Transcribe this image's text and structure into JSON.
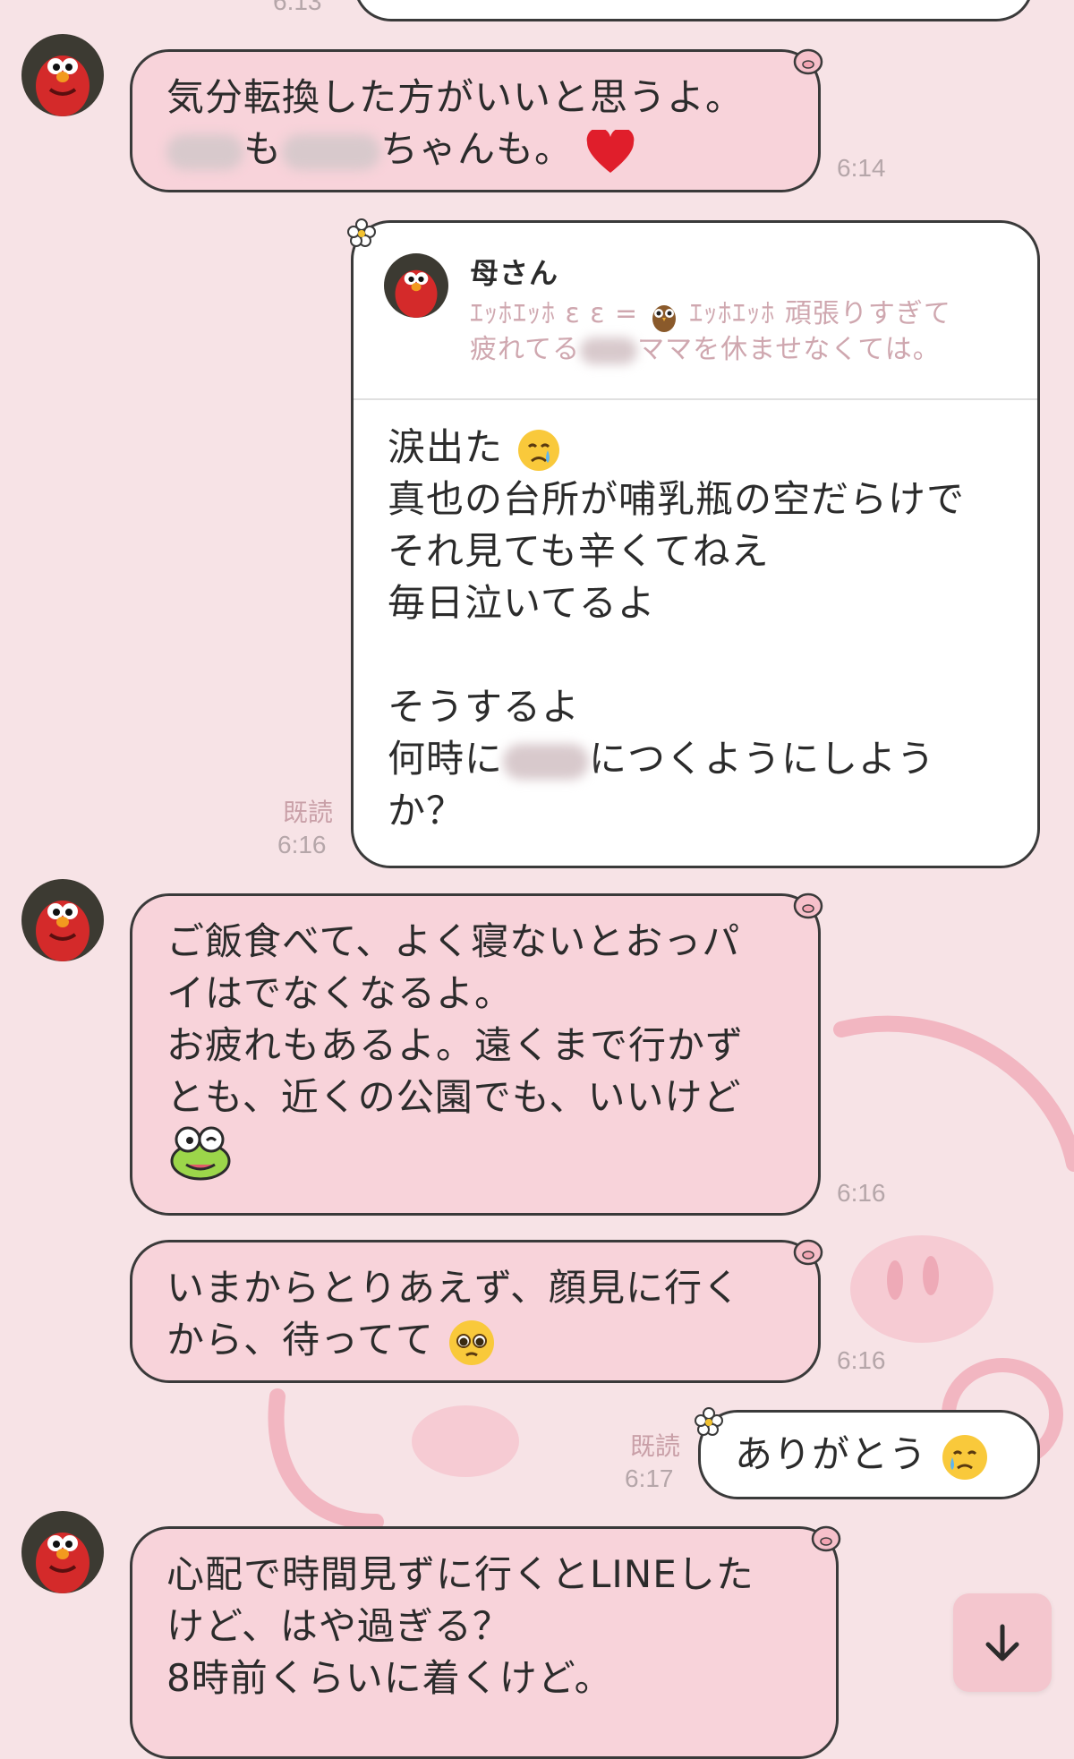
{
  "top_partial": {
    "time": "6:13"
  },
  "messages": [
    {
      "id": "m1",
      "side": "in",
      "lines": [
        "気分転換した方がいいと思うよ。",
        "も",
        "ちゃんも。"
      ],
      "time": "6:14"
    },
    {
      "id": "m2",
      "side": "out",
      "reply": {
        "name": "母さん",
        "line1a": "ｴｯﾎｴｯﾎ",
        "line1b": "ε ε =",
        "line1c": "ｴｯﾎｴｯﾎ 頑張りすぎて",
        "line2a": "疲れてる",
        "line2b": "ママを休ませなくては。"
      },
      "lines": [
        "涙出た",
        "真也の台所が哺乳瓶の空だらけで",
        "それ見ても辛くてねえ",
        "毎日泣いてるよ",
        "",
        "そうするよ",
        "何時に",
        "につくようにしよう",
        "か？"
      ],
      "read": "既読",
      "time": "6:16"
    },
    {
      "id": "m3",
      "side": "in",
      "lines": [
        "ご飯食べて、よく寝ないとおっパ",
        "イはでなくなるよ。",
        "お疲れもあるよ。遠くまで行かず",
        "とも、近くの公園でも、いいけど"
      ],
      "time": "6:16"
    },
    {
      "id": "m4",
      "side": "in",
      "lines": [
        "いまからとりあえず、顔見に行く",
        "から、待ってて"
      ],
      "time": "6:16"
    },
    {
      "id": "m5",
      "side": "out",
      "lines": [
        "ありがとう"
      ],
      "read": "既読",
      "time": "6:17"
    },
    {
      "id": "m6",
      "side": "in",
      "lines": [
        "心配で時間見ずに行くとLINEした",
        "けど、はや過ぎる？",
        "8時前くらいに着くけど。"
      ]
    }
  ],
  "icons": {
    "avatar": "red-monster-avatar",
    "scroll": "arrow-down-icon",
    "sticker_tab": "pig-face-icon",
    "out_tab": "flower-icon"
  },
  "colors": {
    "background": "#f7e3e6",
    "incoming_bubble": "#f8d3da",
    "outgoing_bubble": "#ffffff",
    "border": "#3a3a3a",
    "time_text": "#b5a6a9"
  }
}
